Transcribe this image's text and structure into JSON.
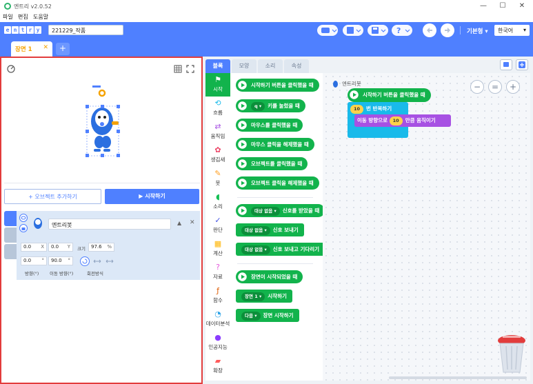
{
  "window": {
    "title": "엔트리 v2.0.52",
    "controls": [
      "—",
      "☐",
      "✕"
    ]
  },
  "menu": [
    "파일",
    "편집",
    "도움말"
  ],
  "header": {
    "logo_letters": [
      "e",
      "n",
      "t",
      "r",
      "y"
    ],
    "project_name": "221229_작품",
    "mode_label": "기본형",
    "language": "한국어"
  },
  "scene": {
    "tab_label": "장면 1",
    "close": "✕",
    "add": "+"
  },
  "stage": {
    "add_object_label": "+ 오브젝트 추가하기",
    "start_label": "▶ 시작하기"
  },
  "object": {
    "name": "엔트리봇",
    "x": "0.0",
    "x_unit": "X",
    "y": "0.0",
    "y_unit": "Y",
    "size_label": "크기",
    "size": "97.6",
    "size_unit": "%",
    "direction": "0.0",
    "direction_unit": "°",
    "move_direction": "90.0",
    "move_direction_unit": "°",
    "direction_label": "방향(°)",
    "move_direction_label": "이동 방향(°)",
    "rotation_label": "회전방식"
  },
  "block_tabs": [
    "블록",
    "모양",
    "소리",
    "속성"
  ],
  "categories": [
    {
      "label": "시작",
      "icon": "flag-icon",
      "glyph": "⚑",
      "color": "#12b34c"
    },
    {
      "label": "흐름",
      "icon": "flow-icon",
      "glyph": "⟲",
      "color": "#19baea"
    },
    {
      "label": "움직임",
      "icon": "move-icon",
      "glyph": "⇄",
      "color": "#a751e3"
    },
    {
      "label": "생김새",
      "icon": "looks-icon",
      "glyph": "✿",
      "color": "#ec4466"
    },
    {
      "label": "붓",
      "icon": "brush-icon",
      "glyph": "✎",
      "color": "#ff9e20"
    },
    {
      "label": "소리",
      "icon": "sound-icon",
      "glyph": "◖",
      "color": "#13bf53"
    },
    {
      "label": "판단",
      "icon": "judge-icon",
      "glyph": "✓",
      "color": "#4252e3"
    },
    {
      "label": "계산",
      "icon": "calc-icon",
      "glyph": "▦",
      "color": "#ffb400"
    },
    {
      "label": "자료",
      "icon": "data-icon",
      "glyph": "?",
      "color": "#e457dc"
    },
    {
      "label": "함수",
      "icon": "func-icon",
      "glyph": "ƒ",
      "color": "#de5c04"
    },
    {
      "label": "데이터분석",
      "icon": "data-analysis-icon",
      "glyph": "◔",
      "color": "#2fa4e7"
    },
    {
      "label": "인공지능",
      "icon": "ai-icon",
      "glyph": "●",
      "color": "#8b3dff"
    },
    {
      "label": "확장",
      "icon": "extension-icon",
      "glyph": "▰",
      "color": "#ff5c5c"
    }
  ],
  "palette_blocks": [
    {
      "text": "시작하기 버튼을 클릭했을 때",
      "pill": ""
    },
    {
      "text": "키를 눌렀을 때",
      "pill": "q ▾"
    },
    {
      "text": "마우스를 클릭했을 때",
      "pill": ""
    },
    {
      "text": "마우스 클릭을 해제했을 때",
      "pill": ""
    },
    {
      "text": "오브젝트를 클릭했을 때",
      "pill": ""
    },
    {
      "text": "오브젝트 클릭을 해제했을 때",
      "pill": ""
    },
    {
      "text": "신호를 받았을 때",
      "pill": "대상 없음 ▾"
    },
    {
      "text": "신호 보내기",
      "pill": "대상 없음 ▾"
    },
    {
      "text": "신호 보내고 기다리기",
      "pill": "대상 없음 ▾"
    },
    {
      "text": "장면이 시작되었을 때",
      "pill": ""
    },
    {
      "text": "시작하기",
      "pill": "장면 1 ▾"
    },
    {
      "text": "장면 시작하기",
      "pill": "다음 ▾"
    }
  ],
  "script": {
    "object_label": "엔트리봇",
    "start_block": "시작하기 버튼을 클릭했을 때",
    "repeat_count": "10",
    "repeat_label": "번 반복하기",
    "move_prefix": "이동 방향으로",
    "move_value": "10",
    "move_suffix": "만큼 움직이기"
  },
  "zoom": [
    "−",
    "=",
    "+"
  ]
}
